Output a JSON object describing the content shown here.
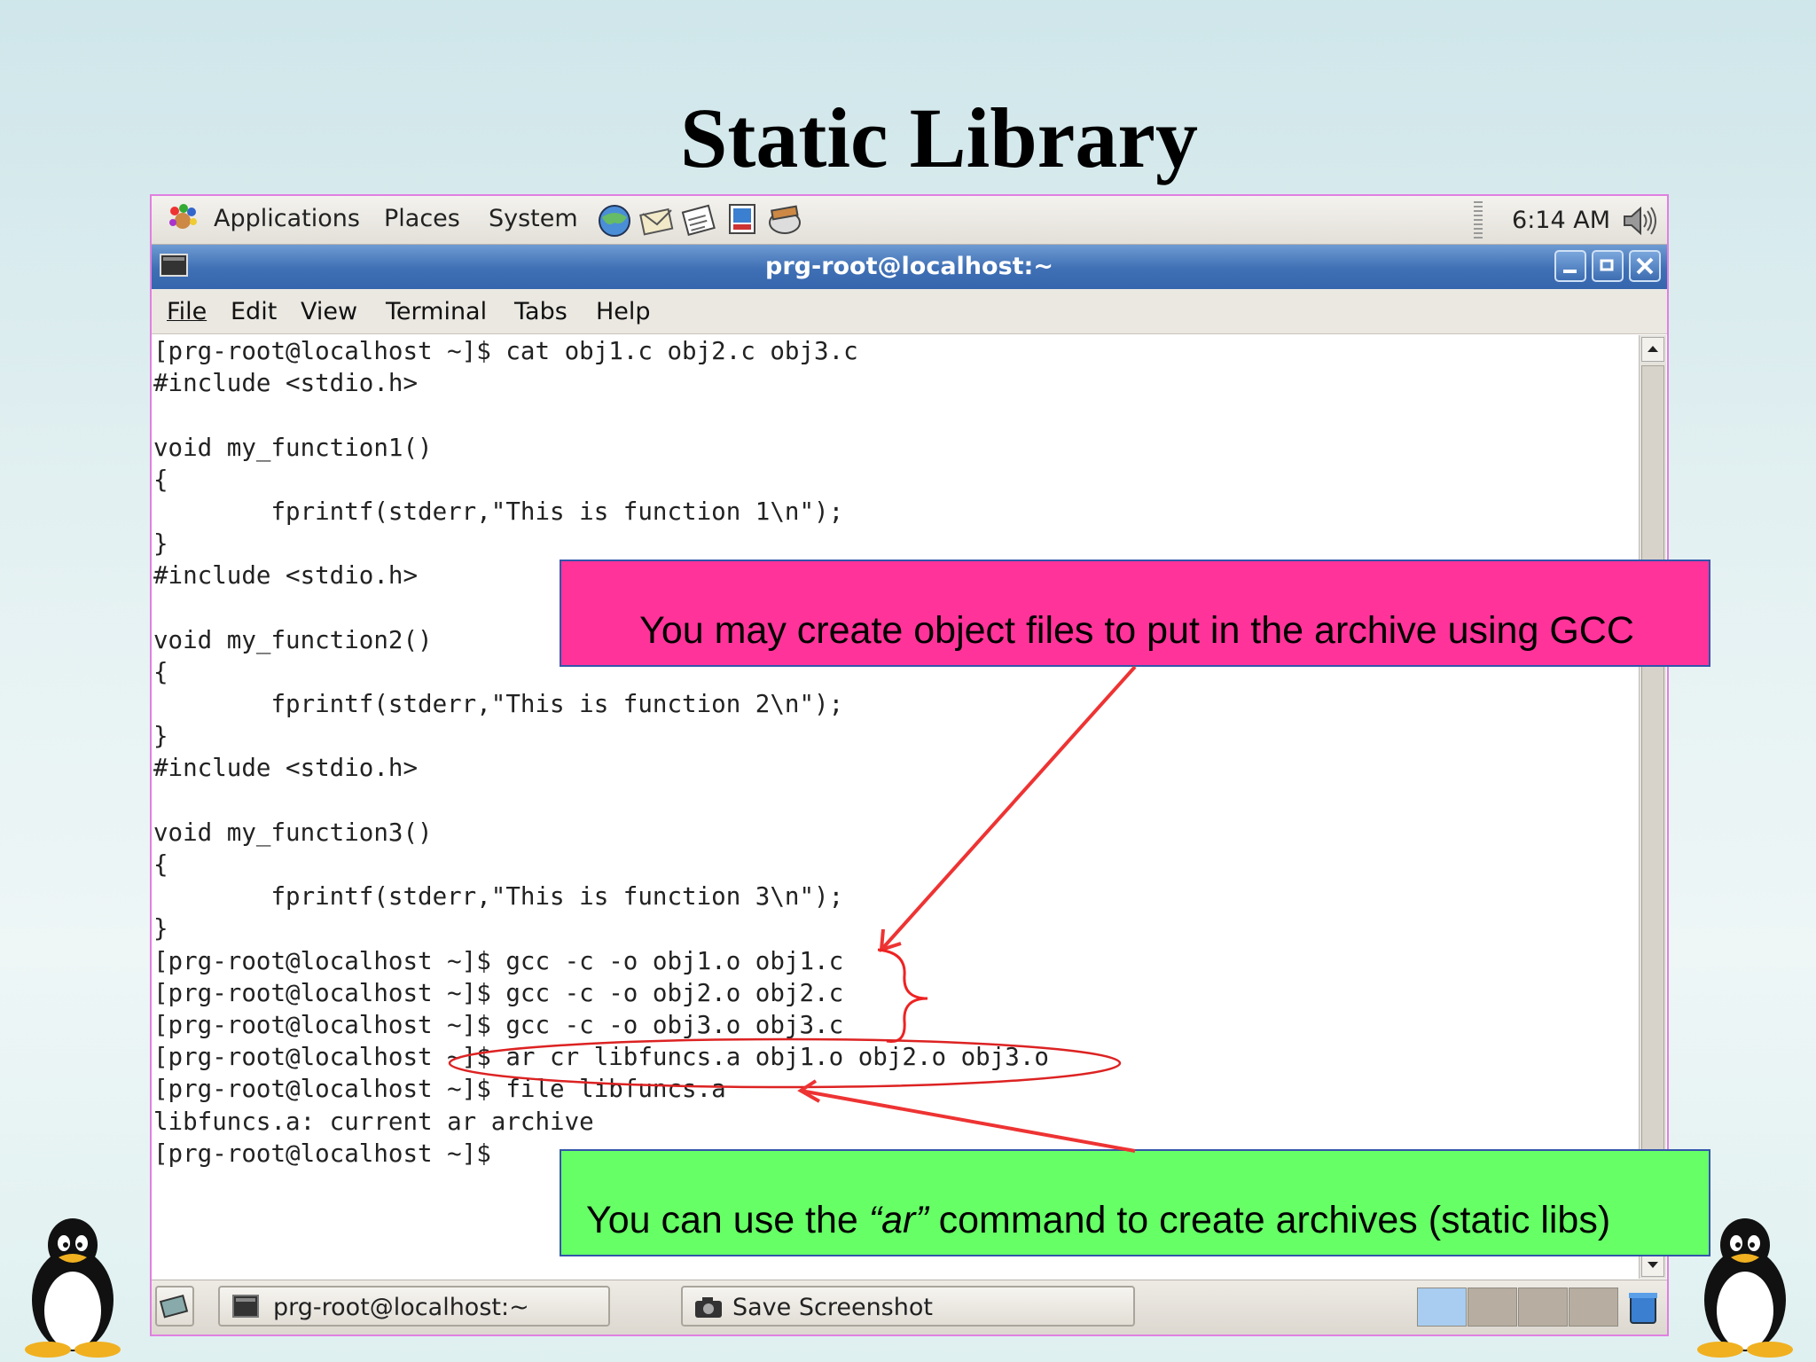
{
  "slide": {
    "title": "Static Library"
  },
  "panel": {
    "menus": [
      "Applications",
      "Places",
      "System"
    ],
    "clock": "6:14 AM"
  },
  "window": {
    "title": "prg-root@localhost:~",
    "menu": [
      "File",
      "Edit",
      "View",
      "Terminal",
      "Tabs",
      "Help"
    ]
  },
  "terminal": {
    "lines": [
      "[prg-root@localhost ~]$ cat obj1.c obj2.c obj3.c",
      "#include <stdio.h>",
      "",
      "void my_function1()",
      "{",
      "        fprintf(stderr,\"This is function 1\\n\");",
      "}",
      "#include <stdio.h>",
      "",
      "void my_function2()",
      "{",
      "        fprintf(stderr,\"This is function 2\\n\");",
      "}",
      "#include <stdio.h>",
      "",
      "void my_function3()",
      "{",
      "        fprintf(stderr,\"This is function 3\\n\");",
      "}",
      "[prg-root@localhost ~]$ gcc -c -o obj1.o obj1.c",
      "[prg-root@localhost ~]$ gcc -c -o obj2.o obj2.c",
      "[prg-root@localhost ~]$ gcc -c -o obj3.o obj3.c",
      "[prg-root@localhost ~]$ ar cr libfuncs.a obj1.o obj2.o obj3.o",
      "[prg-root@localhost ~]$ file libfuncs.a",
      "libfuncs.a: current ar archive",
      "[prg-root@localhost ~]$"
    ]
  },
  "taskbar": {
    "tasks": [
      "prg-root@localhost:~",
      "Save Screenshot"
    ]
  },
  "callouts": {
    "gcc": "You may create object files to put in the archive using GCC",
    "ar_prefix": "You can use the ",
    "ar_cmd": "“ar”",
    "ar_suffix": " command to create archives (static libs)"
  },
  "colors": {
    "callout_gcc": "#ff3399",
    "callout_ar": "#66ff66",
    "arrow": "#ee3333",
    "titlebar": "#3f6fb4"
  }
}
